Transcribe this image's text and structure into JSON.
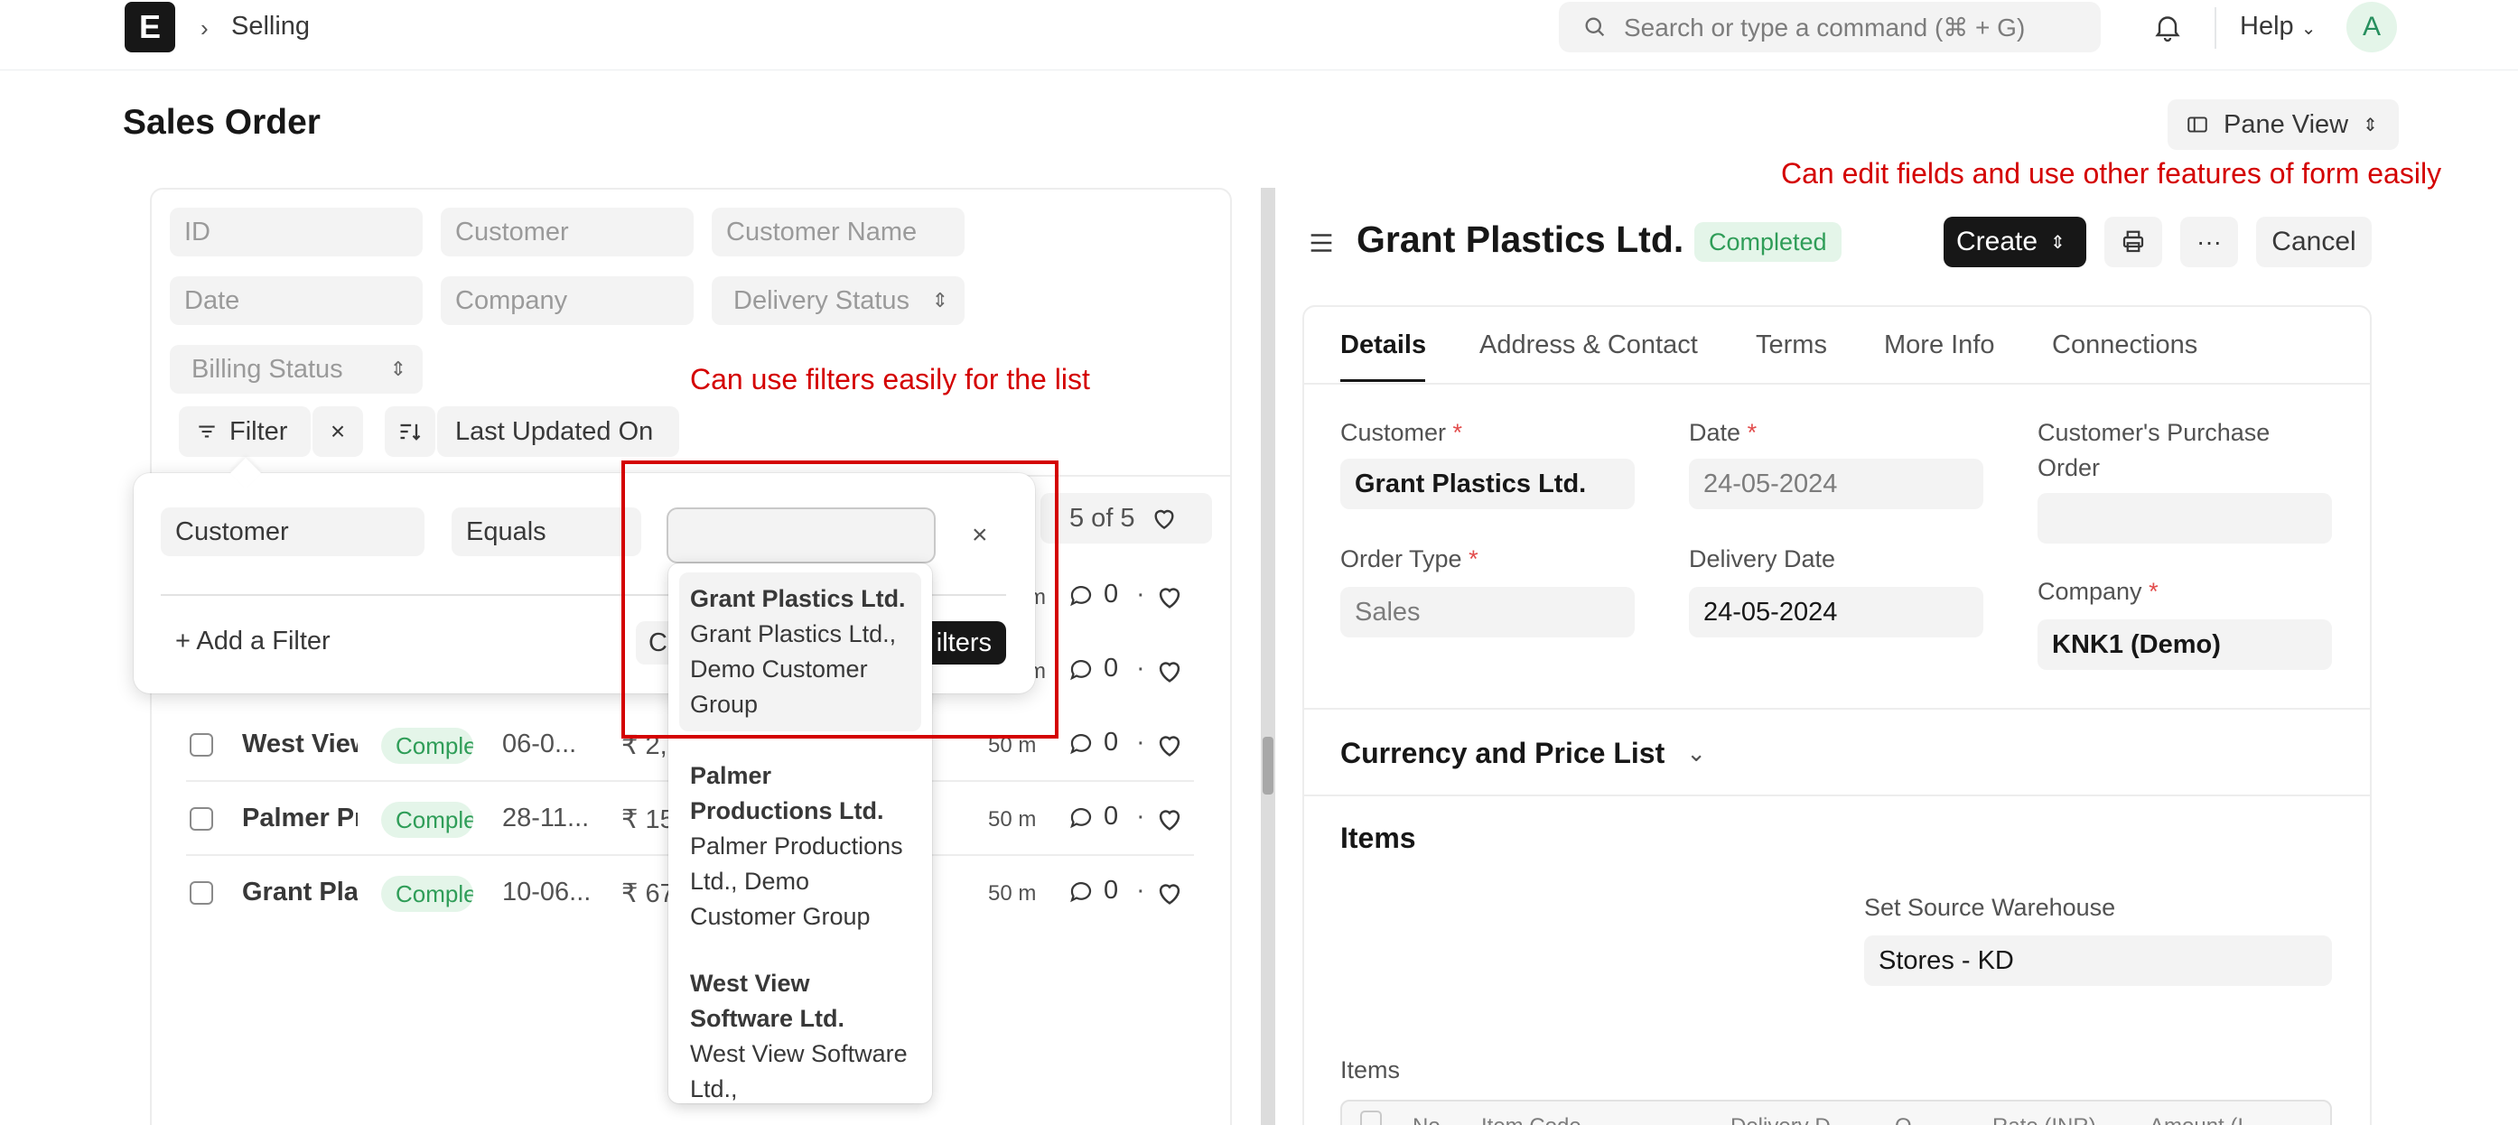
{
  "navbar": {
    "logo_letter": "E",
    "breadcrumb": "Selling",
    "search_placeholder": "Search or type a command (⌘ + G)",
    "help_label": "Help",
    "avatar_initial": "A"
  },
  "page": {
    "title": "Sales Order",
    "pane_view_label": "Pane View"
  },
  "annotations": {
    "form_note": "Can edit fields and use other features of form easily",
    "filter_note": "Can use filters easily for the list"
  },
  "list": {
    "filters": {
      "id": "ID",
      "customer": "Customer",
      "customer_name": "Customer Name",
      "date": "Date",
      "company": "Company",
      "delivery_status": "Delivery Status",
      "billing_status": "Billing Status"
    },
    "filter_button": "Filter",
    "sort_label": "Last Updated On",
    "count": "5 of 5",
    "hidden_rows": [
      {
        "ago": "m",
        "comments": "0"
      },
      {
        "ago": "m",
        "comments": "0"
      }
    ],
    "rows": [
      {
        "name": "West View Software Ltd.",
        "status": "Completed",
        "date": "06-0...",
        "amount": "₹ 2,...",
        "ago": "50 m",
        "comments": "0"
      },
      {
        "name": "Palmer Productions Ltd.",
        "status": "Completed",
        "date": "28-11...",
        "amount": "₹ 15...",
        "ago": "50 m",
        "comments": "0"
      },
      {
        "name": "Grant Plastics Ltd.",
        "status": "Completed",
        "date": "10-06...",
        "amount": "₹ 67...",
        "ago": "50 m",
        "comments": "0"
      }
    ]
  },
  "filter_popover": {
    "field": "Customer",
    "condition": "Equals",
    "value": "",
    "add_filter": "+ Add a Filter",
    "clear_label": "C",
    "apply_label": "ilters",
    "suggestions": [
      {
        "title": "Grant Plastics Ltd.",
        "desc": "Grant Plastics Ltd., Demo Customer Group"
      },
      {
        "title": "Palmer Productions Ltd.",
        "desc": "Palmer Productions Ltd., Demo Customer Group"
      },
      {
        "title": "West View Software Ltd.",
        "desc": "West View Software Ltd.,"
      }
    ]
  },
  "form": {
    "title": "Grant Plastics Ltd.",
    "status": "Completed",
    "create_label": "Create",
    "cancel_label": "Cancel",
    "tabs": [
      "Details",
      "Address & Contact",
      "Terms",
      "More Info",
      "Connections"
    ],
    "fields": {
      "customer_label": "Customer",
      "customer_value": "Grant Plastics Ltd.",
      "date_label": "Date",
      "date_value": "24-05-2024",
      "po_label": "Customer's Purchase Order",
      "po_value": "",
      "order_type_label": "Order Type",
      "order_type_value": "Sales",
      "delivery_date_label": "Delivery Date",
      "delivery_date_value": "24-05-2024",
      "company_label": "Company",
      "company_value": "KNK1 (Demo)",
      "required_mark": "*"
    },
    "currency_section": "Currency and Price List",
    "items_section": "Items",
    "source_warehouse_label": "Set Source Warehouse",
    "source_warehouse_value": "Stores - KD",
    "items_table_label": "Items",
    "items_columns": [
      "No.",
      "Item Code",
      "Delivery D...",
      "Q...",
      "Rate (INR)",
      "Amount (I..."
    ]
  },
  "colors": {
    "accent_dark": "#171717",
    "success_green": "#2f9d58",
    "annotation_red": "#d40000"
  }
}
